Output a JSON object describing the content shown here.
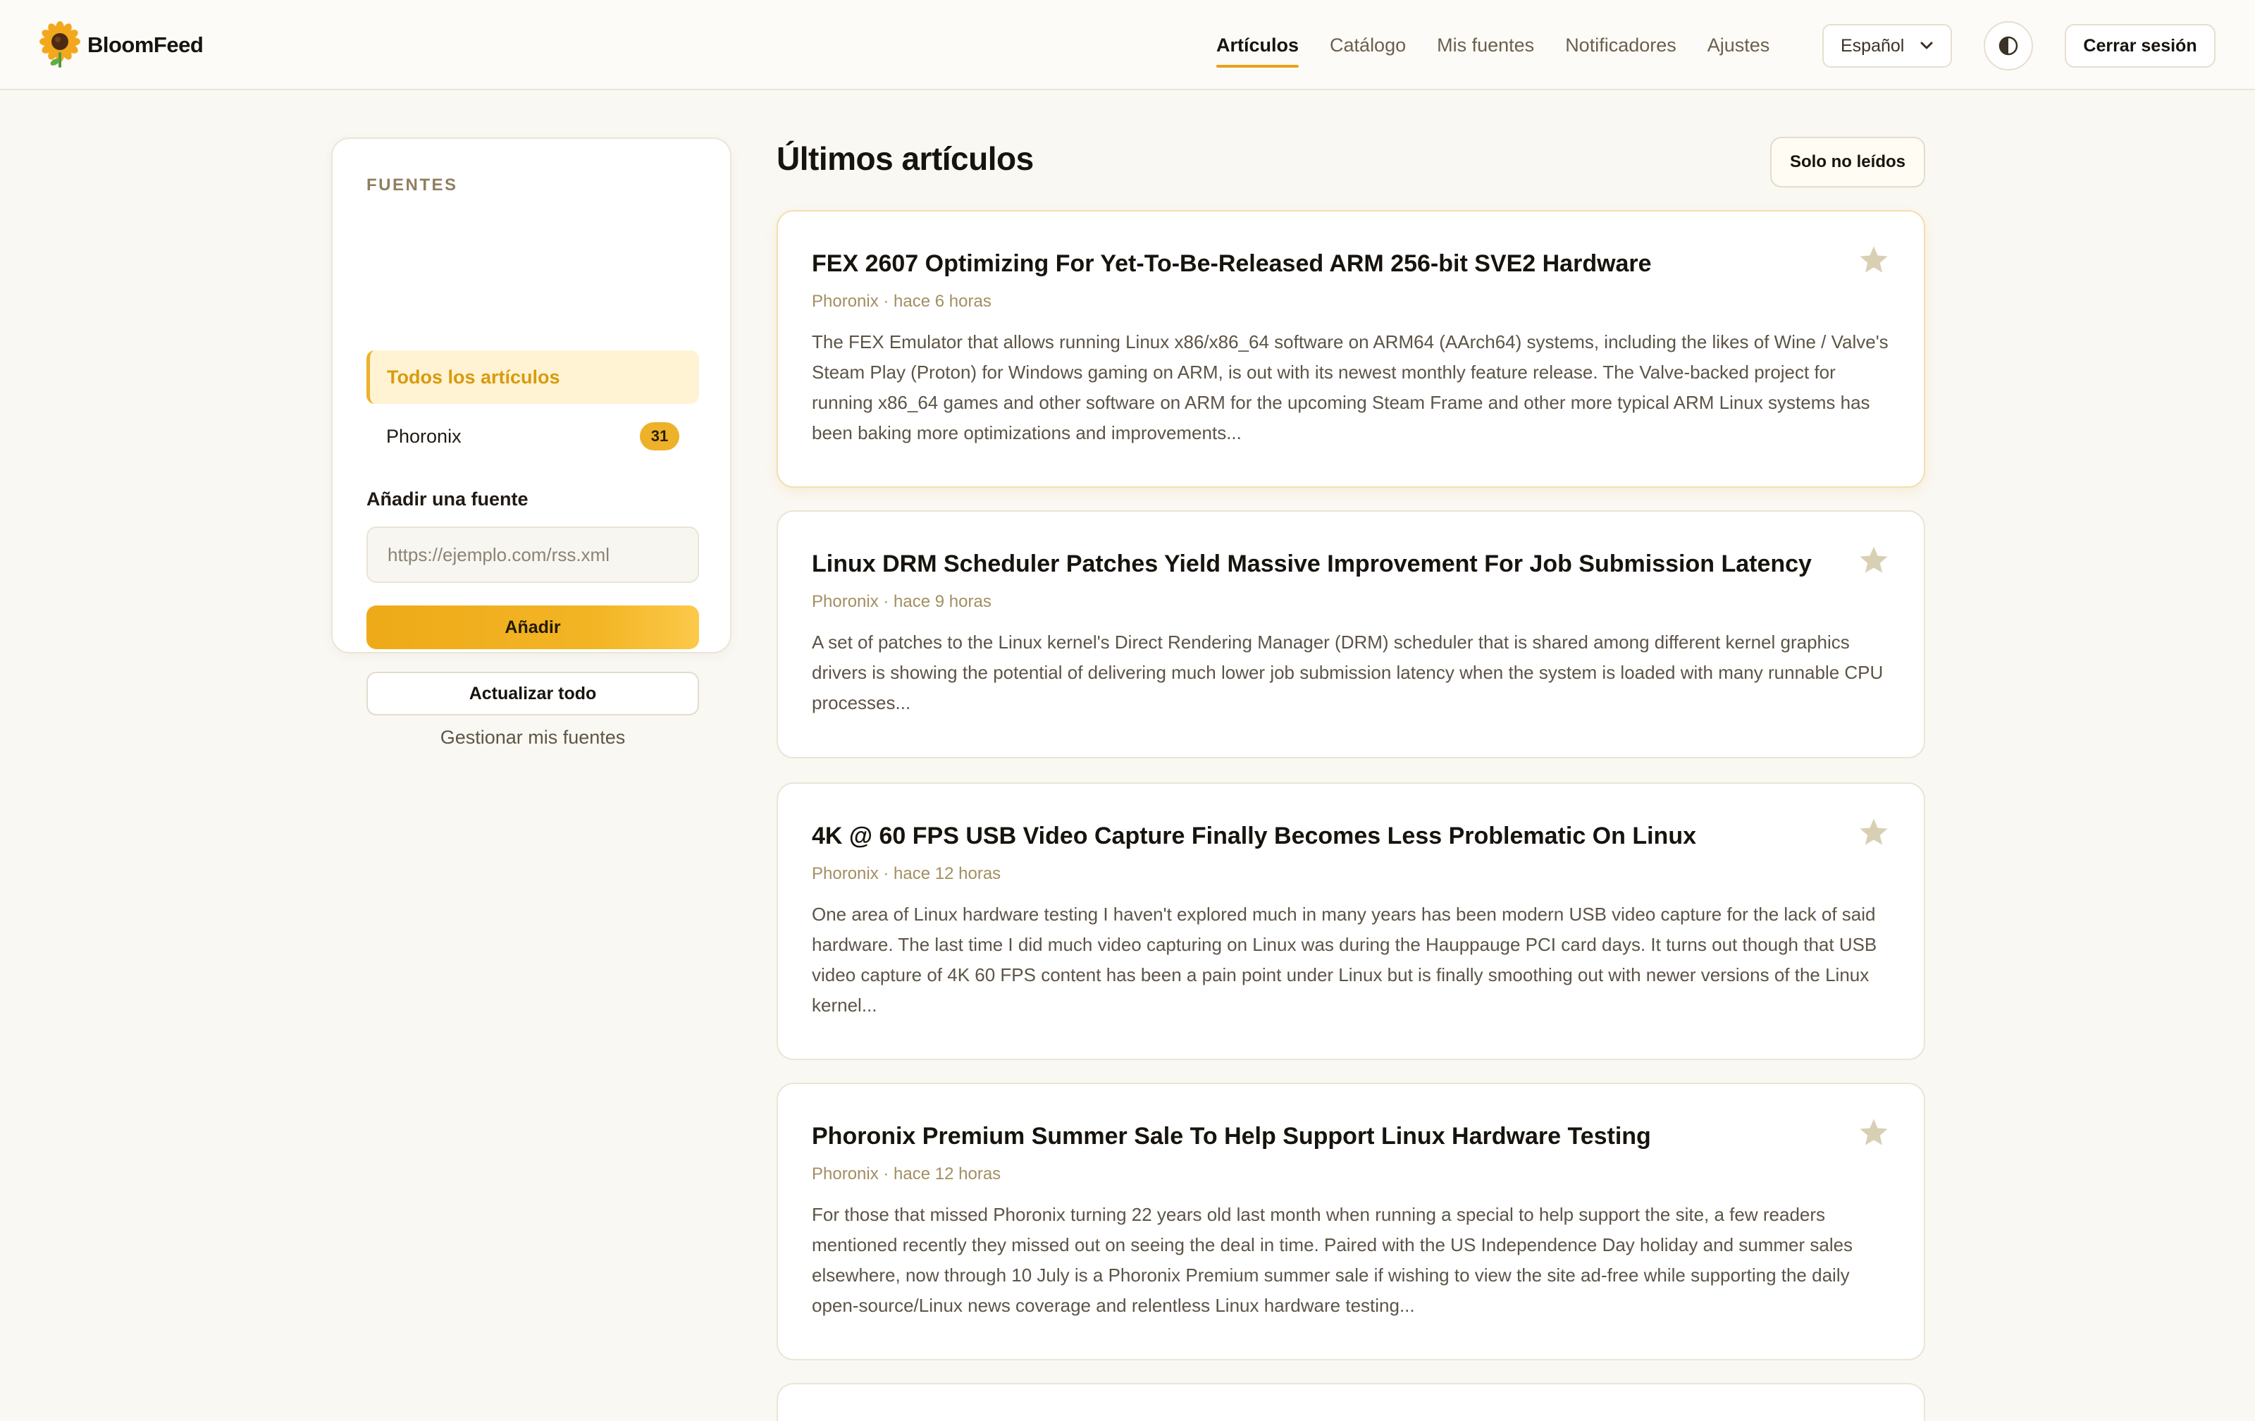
{
  "brand": {
    "name": "BloomFeed"
  },
  "nav": {
    "items": [
      {
        "label": "Artículos",
        "active": true
      },
      {
        "label": "Catálogo",
        "active": false
      },
      {
        "label": "Mis fuentes",
        "active": false
      },
      {
        "label": "Notificadores",
        "active": false
      },
      {
        "label": "Ajustes",
        "active": false
      }
    ],
    "language": "Español",
    "logout_label": "Cerrar sesión"
  },
  "sidebar": {
    "heading": "FUENTES",
    "all_articles_label": "Todos los artículos",
    "feeds": [
      {
        "name": "Phoronix",
        "unread": "31"
      }
    ],
    "add_feed_label": "Añadir una fuente",
    "url_placeholder": "https://ejemplo.com/rss.xml",
    "add_button_label": "Añadir",
    "refresh_button_label": "Actualizar todo",
    "manage_link_label": "Gestionar mis fuentes"
  },
  "main": {
    "title": "Últimos artículos",
    "unread_filter_label": "Solo no leídos",
    "articles": [
      {
        "title": "FEX 2607 Optimizing For Yet-To-Be-Released ARM 256-bit SVE2 Hardware",
        "meta": "Phoronix · hace 6 horas",
        "summary": "The FEX Emulator that allows running Linux x86/x86_64 software on ARM64 (AArch64) systems, including the likes of Wine / Valve's Steam Play (Proton) for Windows gaming on ARM, is out with its newest monthly feature release. The Valve-backed project for running x86_64 games and other software on ARM for the upcoming Steam Frame and other more typical ARM Linux systems has been baking more optimizations and improvements..."
      },
      {
        "title": "Linux DRM Scheduler Patches Yield Massive Improvement For Job Submission Latency",
        "meta": "Phoronix · hace 9 horas",
        "summary": "A set of patches to the Linux kernel's Direct Rendering Manager (DRM) scheduler that is shared among different kernel graphics drivers is showing the potential of delivering much lower job submission latency when the system is loaded with many runnable CPU processes..."
      },
      {
        "title": "4K @ 60 FPS USB Video Capture Finally Becomes Less Problematic On Linux",
        "meta": "Phoronix · hace 12 horas",
        "summary": "One area of Linux hardware testing I haven't explored much in many years has been modern USB video capture for the lack of said hardware. The last time I did much video capturing on Linux was during the Hauppauge PCI card days. It turns out though that USB video capture of 4K 60 FPS content has been a pain point under Linux but is finally smoothing out with newer versions of the Linux kernel..."
      },
      {
        "title": "Phoronix Premium Summer Sale To Help Support Linux Hardware Testing",
        "meta": "Phoronix · hace 12 horas",
        "summary": "For those that missed Phoronix turning 22 years old last month when running a special to help support the site, a few readers mentioned recently they missed out on seeing the deal in time. Paired with the US Independence Day holiday and summer sales elsewhere, now through 10 July is a Phoronix Premium summer sale if wishing to view the site ad-free while supporting the daily open-source/Linux news coverage and relentless Linux hardware testing..."
      }
    ]
  },
  "colors": {
    "accent": "#eeb12a",
    "background": "#faf8f3",
    "star": "#d9cfb4"
  }
}
